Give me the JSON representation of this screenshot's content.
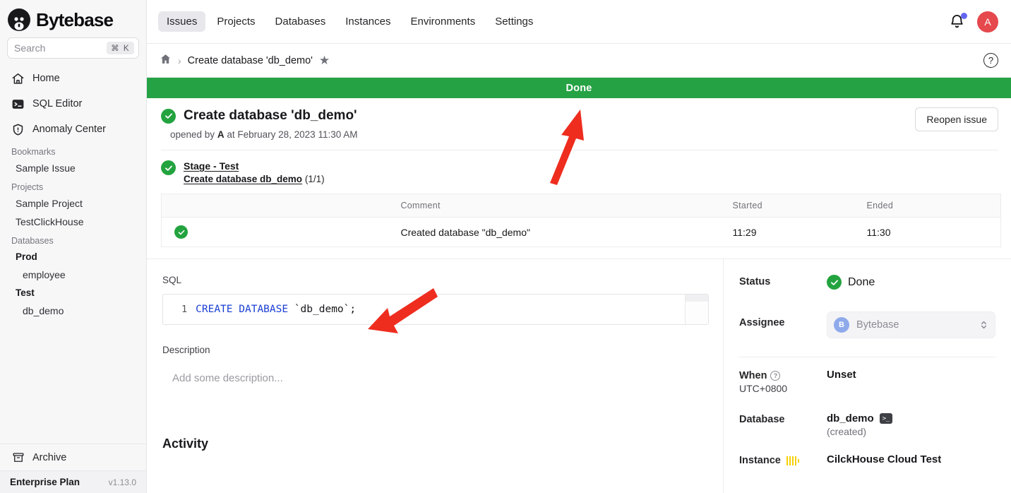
{
  "brand": {
    "name": "Bytebase",
    "logo_icon": "bytebase-logo-icon"
  },
  "search": {
    "placeholder": "Search",
    "shortcut": "⌘ K",
    "icon": "search-icon"
  },
  "sidebar": {
    "nav": [
      {
        "label": "Home",
        "icon": "home-icon"
      },
      {
        "label": "SQL Editor",
        "icon": "terminal-icon"
      },
      {
        "label": "Anomaly Center",
        "icon": "shield-alert-icon"
      }
    ],
    "groups": [
      {
        "label": "Bookmarks",
        "items": [
          {
            "label": "Sample Issue",
            "bold": false
          }
        ]
      },
      {
        "label": "Projects",
        "items": [
          {
            "label": "Sample Project",
            "bold": false
          },
          {
            "label": "TestClickHouse",
            "bold": false
          }
        ]
      },
      {
        "label": "Databases",
        "items": [
          {
            "label": "Prod",
            "bold": true
          },
          {
            "label": "employee",
            "bold": false,
            "indent": true
          },
          {
            "label": "Test",
            "bold": true
          },
          {
            "label": "db_demo",
            "bold": false,
            "indent": true
          }
        ]
      }
    ],
    "archive": {
      "label": "Archive",
      "icon": "archive-icon"
    },
    "plan": {
      "name": "Enterprise Plan",
      "version": "v1.13.0"
    }
  },
  "topbar": {
    "tabs": [
      {
        "label": "Issues",
        "active": true
      },
      {
        "label": "Projects",
        "active": false
      },
      {
        "label": "Databases",
        "active": false
      },
      {
        "label": "Instances",
        "active": false
      },
      {
        "label": "Environments",
        "active": false
      },
      {
        "label": "Settings",
        "active": false
      }
    ],
    "notification_icon": "bell-icon",
    "avatar_initial": "A"
  },
  "breadcrumb": {
    "home_icon": "home-icon",
    "separator": "›",
    "current": "Create database 'db_demo'",
    "star_icon": "star-icon",
    "help_icon": "help-circle-icon",
    "help_glyph": "?"
  },
  "banner": {
    "text": "Done",
    "color": "#25a244"
  },
  "issue": {
    "title": "Create database 'db_demo'",
    "status_icon": "check-circle-icon",
    "opened_prefix": "opened by",
    "opened_by": "A",
    "opened_mid": "at",
    "opened_at": "February 28, 2023 11:30 AM",
    "reopen_label": "Reopen issue"
  },
  "stage": {
    "status_icon": "check-circle-icon",
    "name": "Stage - Test",
    "task_name": "Create database db_demo",
    "task_count": "(1/1)"
  },
  "task_table": {
    "headers": [
      "",
      "",
      "Comment",
      "Started",
      "Ended"
    ],
    "rows": [
      {
        "status_icon": "check-circle-icon",
        "comment": "Created database \"db_demo\"",
        "started": "11:29",
        "ended": "11:30"
      }
    ]
  },
  "sql_section": {
    "label": "SQL",
    "line_number": "1",
    "keyword": "CREATE DATABASE",
    "literal": "`db_demo`;"
  },
  "description_section": {
    "label": "Description",
    "placeholder": "Add some description..."
  },
  "activity": {
    "title": "Activity"
  },
  "details": {
    "status": {
      "label": "Status",
      "value": "Done",
      "icon": "check-circle-icon"
    },
    "assignee": {
      "label": "Assignee",
      "avatar_initial": "B",
      "value": "Bytebase",
      "chevron_icon": "chevron-updown-icon"
    },
    "when": {
      "label": "When",
      "help_icon": "help-circle-icon",
      "help_glyph": "?",
      "timezone": "UTC+0800",
      "value": "Unset"
    },
    "database": {
      "label": "Database",
      "value": "db_demo",
      "terminal_icon": "terminal-icon",
      "state": "(created)"
    },
    "instance": {
      "label": "Instance",
      "engine_icon": "clickhouse-logo-icon",
      "value": "CilckHouse Cloud Test"
    }
  },
  "annotations": {
    "arrow_color": "#ee2d1f",
    "arrows": [
      {
        "name": "arrow-to-done-banner"
      },
      {
        "name": "arrow-to-sql-statement"
      }
    ]
  }
}
